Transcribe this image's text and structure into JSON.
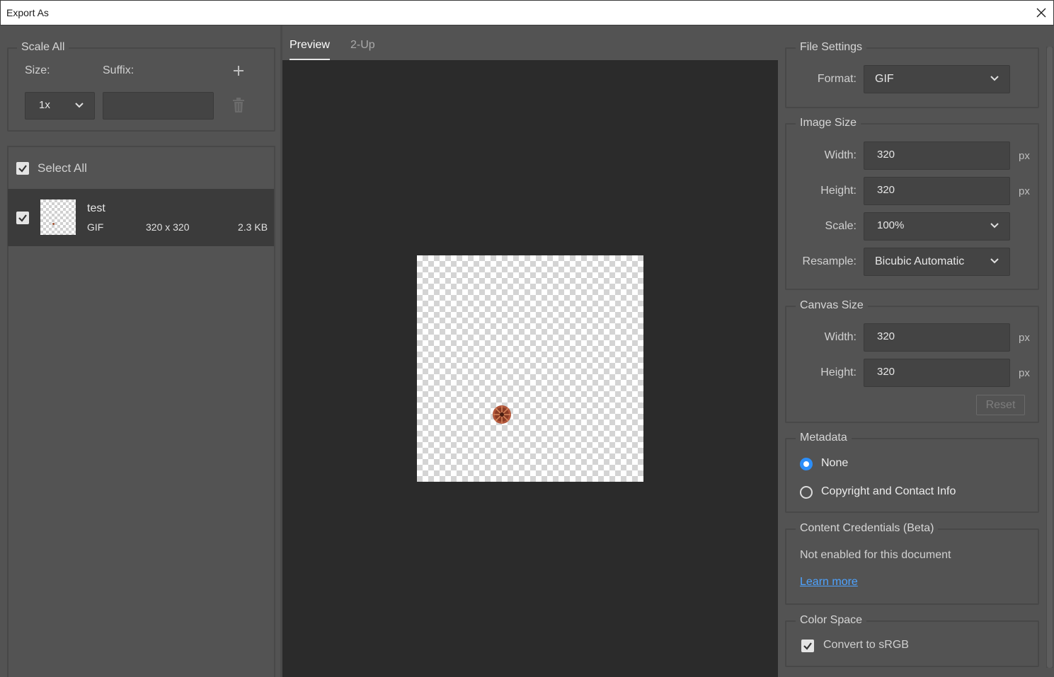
{
  "window": {
    "title": "Export As"
  },
  "scale_all": {
    "legend": "Scale All",
    "size_label": "Size:",
    "suffix_label": "Suffix:",
    "size_value": "1x",
    "suffix_value": ""
  },
  "asset_list": {
    "select_all_label": "Select All",
    "items": [
      {
        "name": "test",
        "format": "GIF",
        "dimensions": "320 x 320",
        "file_size": "2.3 KB"
      }
    ]
  },
  "tabs": [
    {
      "label": "Preview",
      "active": true
    },
    {
      "label": "2-Up",
      "active": false
    }
  ],
  "file_settings": {
    "legend": "File Settings",
    "format_label": "Format:",
    "format_value": "GIF"
  },
  "image_size": {
    "legend": "Image Size",
    "width_label": "Width:",
    "width_value": "320",
    "height_label": "Height:",
    "height_value": "320",
    "unit": "px",
    "scale_label": "Scale:",
    "scale_value": "100%",
    "resample_label": "Resample:",
    "resample_value": "Bicubic Automatic"
  },
  "canvas_size": {
    "legend": "Canvas Size",
    "width_label": "Width:",
    "width_value": "320",
    "height_label": "Height:",
    "height_value": "320",
    "unit": "px",
    "reset_label": "Reset"
  },
  "metadata": {
    "legend": "Metadata",
    "options": [
      {
        "label": "None",
        "selected": true
      },
      {
        "label": "Copyright and Contact Info",
        "selected": false
      }
    ]
  },
  "content_credentials": {
    "legend": "Content Credentials (Beta)",
    "status": "Not enabled for this document",
    "link": "Learn more"
  },
  "color_space": {
    "legend": "Color Space",
    "convert_label": "Convert to sRGB",
    "convert_checked": true
  },
  "colors": {
    "panel_bg": "#535353",
    "preview_bg": "#2b2b2b",
    "accent": "#2c8ef8",
    "link": "#4ea3ff"
  }
}
